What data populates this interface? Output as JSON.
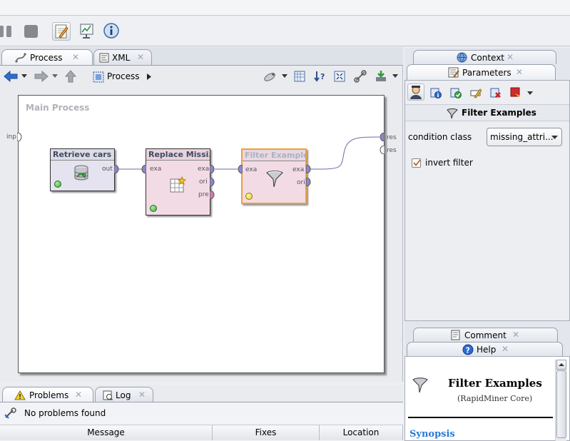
{
  "toolbar": {
    "buttons": [
      {
        "name": "pause-icon"
      },
      {
        "name": "stop-icon"
      },
      {
        "name": "design-perspective-icon",
        "selected": true
      },
      {
        "name": "results-perspective-icon"
      },
      {
        "name": "welcome-info-icon"
      }
    ]
  },
  "editor_tabs": [
    {
      "label": "Process",
      "icon": "process-icon"
    },
    {
      "label": "XML",
      "icon": "xml-icon"
    }
  ],
  "nav": {
    "process_label": "Process"
  },
  "canvas": {
    "title": "Main Process",
    "left_port": "inp",
    "right_ports": [
      "res",
      "res"
    ],
    "operators": [
      {
        "name": "Retrieve cars",
        "in_ports": [],
        "out_ports": [
          "out"
        ],
        "status": "green"
      },
      {
        "name": "Replace Missi...",
        "in_ports": [
          "exa"
        ],
        "out_ports": [
          "exa",
          "ori",
          "pre"
        ],
        "status": "green"
      },
      {
        "name": "Filter Examples",
        "in_ports": [
          "exa"
        ],
        "out_ports": [
          "exa",
          "ori"
        ],
        "status": "yellow",
        "selected": true
      }
    ]
  },
  "right_tabs": {
    "context": "Context",
    "parameters": "Parameters",
    "comment": "Comment",
    "help": "Help"
  },
  "parameters": {
    "operator_title": "Filter Examples",
    "condition_label": "condition class",
    "condition_value": "missing_attri...",
    "invert_label": "invert filter",
    "invert_checked": true
  },
  "help": {
    "title": "Filter Examples",
    "subtitle": "(RapidMiner Core)",
    "section": "Synopsis"
  },
  "bottom_tabs": [
    {
      "label": "Problems",
      "icon": "warning-icon"
    },
    {
      "label": "Log",
      "icon": "log-icon"
    }
  ],
  "problems": {
    "status": "No problems found",
    "columns": [
      "Message",
      "Fixes",
      "Location"
    ]
  },
  "colors": {
    "selected_border": "#f0a036",
    "link_blue": "#2a7ad8"
  }
}
